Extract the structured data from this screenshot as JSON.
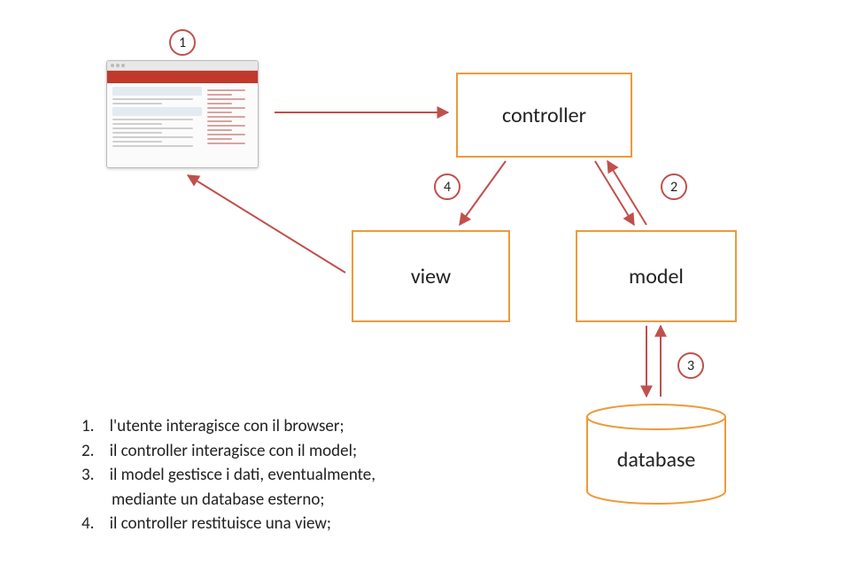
{
  "boxes": {
    "controller": "controller",
    "view": "view",
    "model": "model",
    "database": "database"
  },
  "steps": {
    "s1": "1",
    "s2": "2",
    "s3": "3",
    "s4": "4"
  },
  "legend": {
    "n1": "1.",
    "t1": "l'utente interagisce con il browser;",
    "n2": "2.",
    "t2": "il controller interagisce con il model;",
    "n3": "3.",
    "t3a": "il model gestisce i dati, eventualmente,",
    "t3b": "mediante un database esterno;",
    "n4": "4.",
    "t4": "il controller restituisce una view;"
  },
  "colors": {
    "arrow": "#c0504d",
    "box_border": "#ed9a3a"
  }
}
